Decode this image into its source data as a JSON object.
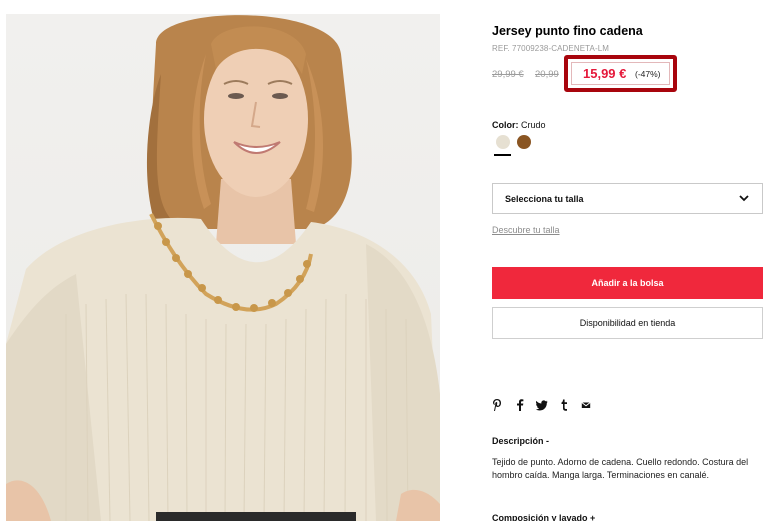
{
  "product": {
    "title": "Jersey punto fino cadena",
    "ref": "REF. 77009238-CADENETA-LM"
  },
  "prices": {
    "original_1": "29,99 €",
    "original_2": "20,99",
    "sale": "15,99 €",
    "discount": "(-47%)"
  },
  "color": {
    "label": "Color:",
    "selected": "Crudo",
    "swatches": [
      {
        "name": "Crudo",
        "hex": "#e6e0d2"
      },
      {
        "name": "Marrón",
        "hex": "#8a5522"
      }
    ]
  },
  "size": {
    "select_label": "Selecciona tu talla",
    "guide_link": "Descubre tu talla"
  },
  "actions": {
    "add_to_bag": "Añadir a la bolsa",
    "store_availability": "Disponibilidad en tienda"
  },
  "share_icons": [
    "pinterest-icon",
    "facebook-icon",
    "twitter-icon",
    "tumblr-icon",
    "mail-icon"
  ],
  "description": {
    "heading": "Descripción  -",
    "text": "Tejido de punto. Adorno de cadena. Cuello redondo. Costura del hombro caída. Manga larga. Terminaciones en canalé."
  },
  "composition": {
    "heading": "Composición y lavado  +"
  },
  "colors": {
    "sale_red": "#e5183a",
    "button_red": "#f0283c",
    "highlight_box": "#a8050d"
  }
}
